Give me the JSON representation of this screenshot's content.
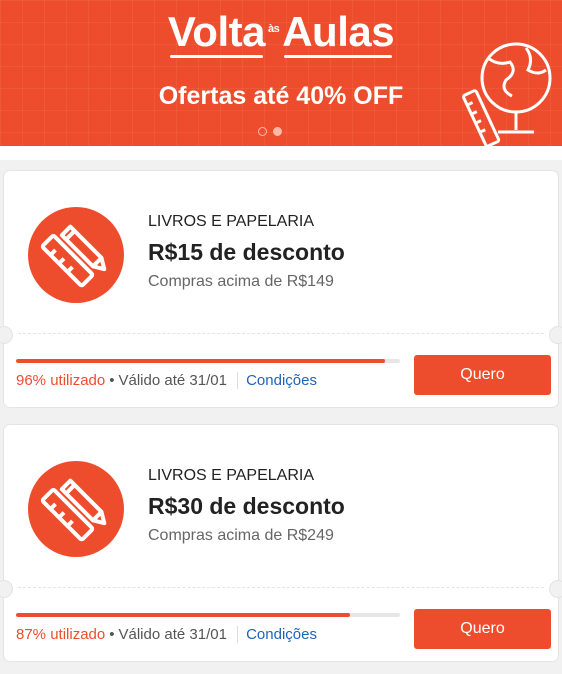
{
  "banner": {
    "title_part1": "Volta",
    "title_small": "às",
    "title_part2": "Aulas",
    "subtitle": "Ofertas até 40% OFF"
  },
  "vouchers": [
    {
      "category": "LIVROS E PAPELARIA",
      "amount": "R$15 de desconto",
      "min_purchase": "Compras acima de R$149",
      "used_label": "96% utilizado",
      "used_fraction": 0.96,
      "validity": "Válido até 31/01",
      "conditions_label": "Condições",
      "button_label": "Quero"
    },
    {
      "category": "LIVROS E PAPELARIA",
      "amount": "R$30 de desconto",
      "min_purchase": "Compras acima de R$249",
      "used_label": "87% utilizado",
      "used_fraction": 0.87,
      "validity": "Válido até 31/01",
      "conditions_label": "Condições",
      "button_label": "Quero"
    }
  ],
  "colors": {
    "accent": "#ee4d2d",
    "link": "#1e64b4"
  },
  "icons": [
    "pencil-ruler-icon",
    "globe-icon",
    "ruler-icon"
  ]
}
